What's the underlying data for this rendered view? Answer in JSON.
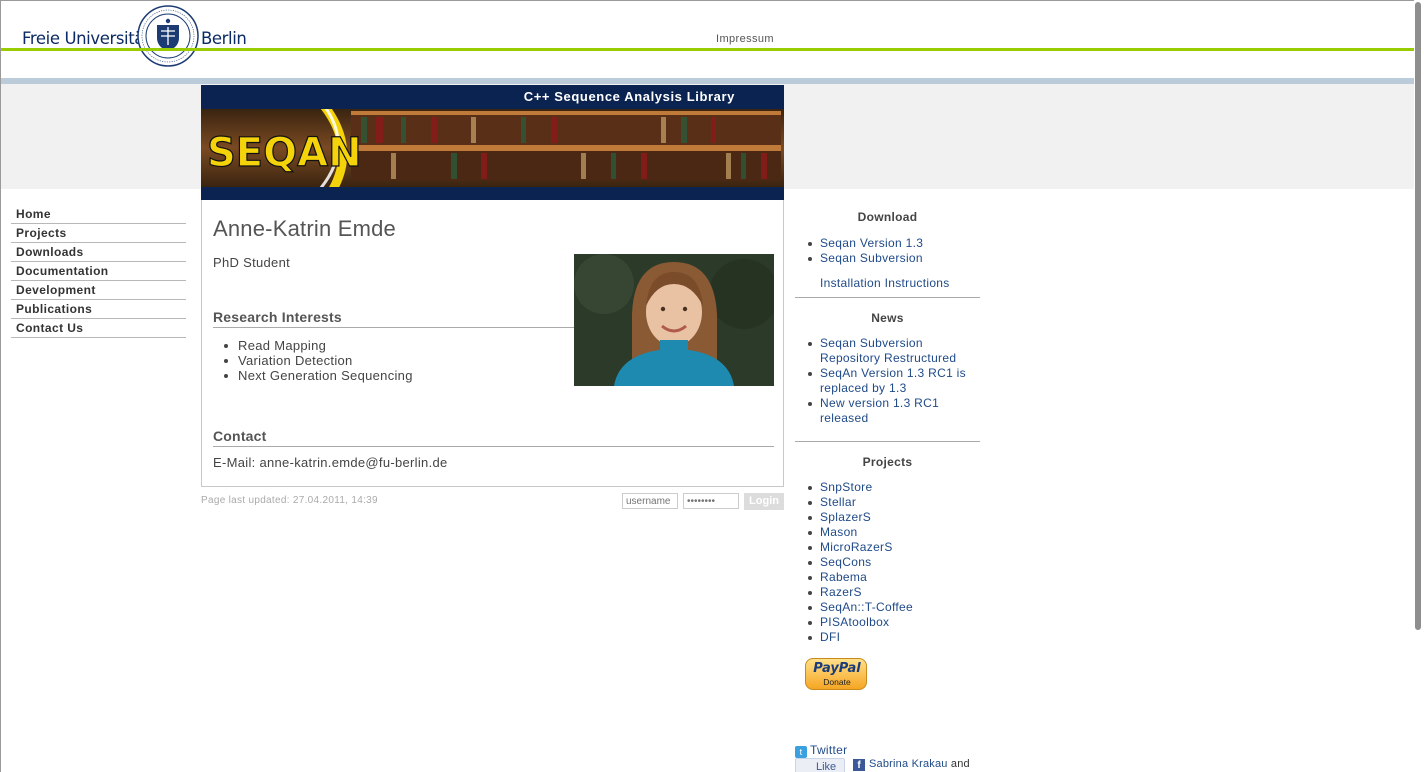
{
  "header": {
    "logo_left": "Freie Universität",
    "logo_right": "Berlin",
    "impressum": "Impressum"
  },
  "banner": {
    "title": "C++ Sequence Analysis Library",
    "logo_text": "SEQAN"
  },
  "nav": {
    "items": [
      {
        "label": "Home"
      },
      {
        "label": "Projects"
      },
      {
        "label": "Downloads"
      },
      {
        "label": "Documentation"
      },
      {
        "label": "Development"
      },
      {
        "label": "Publications"
      },
      {
        "label": "Contact Us"
      }
    ]
  },
  "profile": {
    "name": "Anne-Katrin Emde",
    "role": "PhD Student",
    "research_heading": "Research Interests",
    "interests": [
      "Read Mapping",
      "Variation Detection",
      "Next Generation Sequencing"
    ],
    "contact_heading": "Contact",
    "email_line": "E-Mail: anne-katrin.emde@fu-berlin.de"
  },
  "footer": {
    "last_updated": "Page last updated: 27.04.2011, 14:39",
    "username_placeholder": "username",
    "password_placeholder": "••••••••",
    "login_label": "Login"
  },
  "sidebar": {
    "download_heading": "Download",
    "download_items": [
      "Seqan Version 1.3",
      "Seqan Subversion"
    ],
    "install_link": "Installation Instructions",
    "news_heading": "News",
    "news_items": [
      [
        "Seqan Subversion",
        "Repository Restructured"
      ],
      [
        "SeqAn Version 1.3 RC1 is",
        "replaced by 1.3"
      ],
      [
        "New version 1.3 RC1",
        "released"
      ]
    ],
    "projects_heading": "Projects",
    "project_items": [
      "SnpStore",
      "Stellar",
      "SplazerS",
      "Mason",
      "MicroRazerS",
      "SeqCons",
      "Rabema",
      "RazerS",
      "SeqAn::T-Coffee",
      "PISAtoolbox",
      "DFI"
    ],
    "paypal": "PayPal",
    "paypal_donate": "Donate",
    "twitter": "Twitter",
    "fb_like": "Like",
    "fb_friend": "Sabrina Krakau",
    "fb_and": "and"
  },
  "colors": {
    "accent_green": "#99cc00",
    "banner_navy": "#0b2350",
    "link_blue": "#1f4a88"
  }
}
